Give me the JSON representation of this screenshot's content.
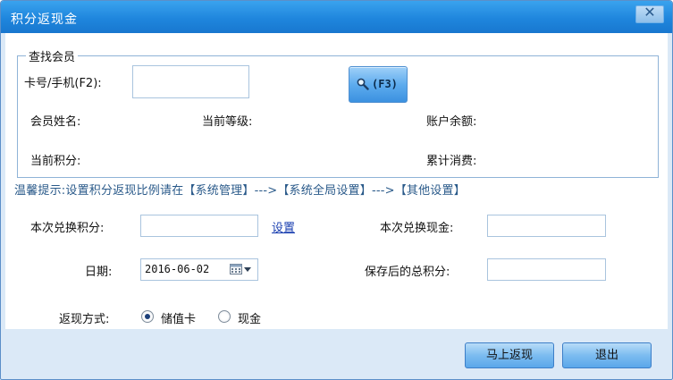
{
  "window": {
    "title": "积分返现金",
    "close_label": "✕"
  },
  "member_search": {
    "group_title": "查找会员",
    "card_label": "卡号/手机(F2):",
    "card_value": "",
    "search_button_label": "(F3)",
    "name_label": "会员姓名:",
    "level_label": "当前等级:",
    "balance_label": "账户余额:",
    "points_label": "当前积分:",
    "total_spent_label": "累计消费:"
  },
  "tip": "温馨提示:设置积分返现比例请在【系统管理】--->【系统全局设置】--->【其他设置】",
  "form": {
    "exchange_points_label": "本次兑换积分:",
    "exchange_points_value": "",
    "settings_link": "设置",
    "exchange_cash_label": "本次兑换现金:",
    "exchange_cash_value": "",
    "date_label": "日期:",
    "date_value": "2016-06-02",
    "saved_total_label": "保存后的总积分:",
    "saved_total_value": "",
    "refund_method_label": "返现方式:",
    "refund_options": [
      "储值卡",
      "现金"
    ],
    "refund_selected": "储值卡"
  },
  "footer": {
    "refund_now_label": "马上返现",
    "exit_label": "退出"
  },
  "colors": {
    "titlebar": "#1f86dd",
    "window_bg": "#dbe9f7",
    "tip_text": "#2a5a8a",
    "link": "#1a3fb0"
  }
}
